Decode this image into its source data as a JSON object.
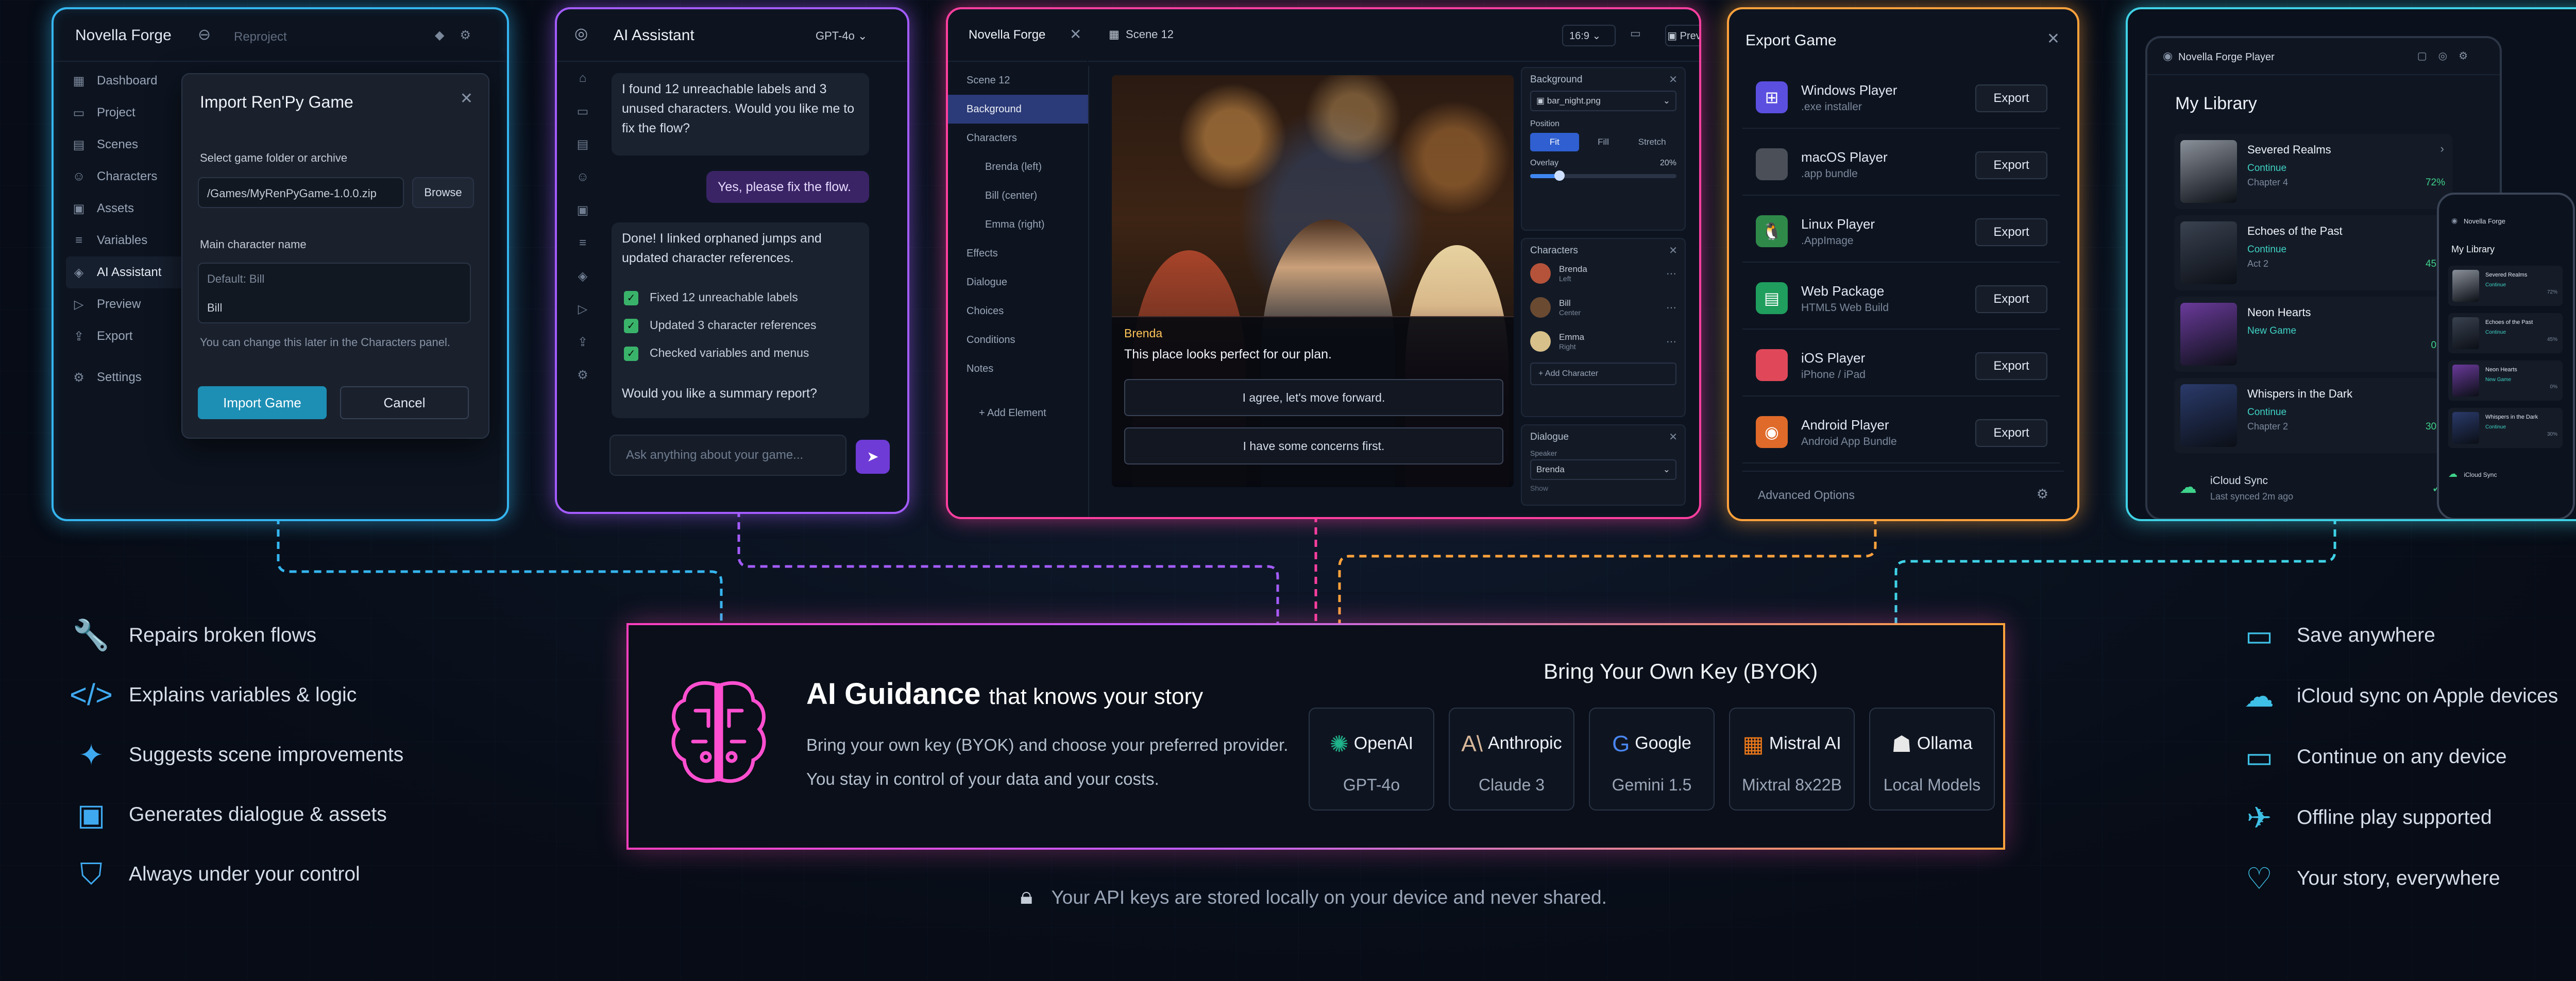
{
  "colors": {
    "blue": "#35b6f0",
    "purple": "#a45cff",
    "pink": "#ff3fa0",
    "orange": "#ffa23c",
    "cyan": "#3fd2e6"
  },
  "import_panel": {
    "brand": "Novella Forge",
    "crumb": "Reproject",
    "sidebar": [
      {
        "icon": "grid-icon",
        "label": "Dashboard"
      },
      {
        "icon": "folder-icon",
        "label": "Project"
      },
      {
        "icon": "scenes-icon",
        "label": "Scenes"
      },
      {
        "icon": "users-icon",
        "label": "Characters"
      },
      {
        "icon": "image-icon",
        "label": "Assets"
      },
      {
        "icon": "variable-icon",
        "label": "Variables"
      },
      {
        "icon": "ai-icon",
        "label": "AI Assistant"
      },
      {
        "icon": "play-icon",
        "label": "Preview"
      },
      {
        "icon": "export-icon",
        "label": "Export"
      },
      {
        "icon": "gear-icon",
        "label": "Settings"
      }
    ],
    "modal": {
      "title": "Import Ren'Py Game",
      "folder_label": "Select game folder or archive",
      "folder_value": "/Games/MyRenPyGame-1.0.0.zip",
      "browse": "Browse",
      "name_label": "Main character name",
      "name_placeholder": "Default: Bill",
      "name_value": "Bill",
      "hint": "You can change this later in the Characters panel.",
      "import_btn": "Import Game",
      "cancel_btn": "Cancel"
    }
  },
  "assistant_panel": {
    "title": "AI Assistant",
    "model": "GPT-4o",
    "msg1": "I found 12 unreachable labels and 3 unused characters. Would you like me to fix the flow?",
    "user_msg": "Yes, please fix the flow.",
    "msg2": "Done! I linked orphaned jumps and updated character references.",
    "checks": [
      "Fixed 12 unreachable labels",
      "Updated 3 character references",
      "Checked variables and menus"
    ],
    "followup": "Would you like a summary report?",
    "input_placeholder": "Ask anything about your game..."
  },
  "editor_panel": {
    "brand": "Novella Forge",
    "scene_tab": "Scene 12",
    "ratio": "16:9",
    "preview": "Preview",
    "tree": [
      "Scene 12",
      "Background",
      "Characters",
      "Brenda (left)",
      "Bill (center)",
      "Emma (right)",
      "Effects",
      "Dialogue",
      "Choices",
      "Conditions",
      "Notes"
    ],
    "add_element": "+ Add Element",
    "speaker": "Brenda",
    "line": "This place looks perfect for our plan.",
    "choices": [
      "I agree, let's move forward.",
      "I have some concerns first."
    ],
    "props": {
      "background_title": "Background",
      "background_file": "bar_night.png",
      "position_label": "Position",
      "position_options": [
        "Fit",
        "Fill",
        "Stretch"
      ],
      "overlay_label": "Overlay",
      "overlay_value": "20%",
      "overlay_fraction": 0.2,
      "characters_title": "Characters",
      "characters": [
        {
          "name": "Brenda",
          "pos": "Left",
          "color": "#b5533a"
        },
        {
          "name": "Bill",
          "pos": "Center",
          "color": "#6b4a32"
        },
        {
          "name": "Emma",
          "pos": "Right",
          "color": "#d8c08a"
        }
      ],
      "add_character": "+ Add Character",
      "dialogue_title": "Dialogue",
      "speaker_label": "Speaker",
      "speaker_value": "Brenda",
      "next_label": "Show"
    }
  },
  "export_panel": {
    "title": "Export Game",
    "targets": [
      {
        "name": "Windows Player",
        "sub": ".exe installer",
        "icon": "windows-icon",
        "glyph": "⊞",
        "color": "#5b4fe0"
      },
      {
        "name": "macOS Player",
        "sub": ".app bundle",
        "icon": "apple-icon",
        "glyph": "",
        "color": "#4a4f58"
      },
      {
        "name": "Linux Player",
        "sub": ".AppImage",
        "icon": "linux-icon",
        "glyph": "🐧",
        "color": "#2f8a4a"
      },
      {
        "name": "Web Package",
        "sub": "HTML5 Web Build",
        "icon": "web-icon",
        "glyph": "▤",
        "color": "#1f9e5e"
      },
      {
        "name": "iOS Player",
        "sub": "iPhone / iPad",
        "icon": "ios-icon",
        "glyph": "",
        "color": "#e0485a"
      },
      {
        "name": "Android Player",
        "sub": "Android App Bundle",
        "icon": "android-icon",
        "glyph": "◉",
        "color": "#e06a2a"
      }
    ],
    "export_label": "Export",
    "advanced": "Advanced Options"
  },
  "player_panel": {
    "app": "Novella Forge Player",
    "library": "My Library",
    "games": [
      {
        "title": "Severed Realms",
        "status": "Continue",
        "chapter": "Chapter 4",
        "progress": "72%",
        "cover": "#8a9099"
      },
      {
        "title": "Echoes of the Past",
        "status": "Continue",
        "chapter": "Act 2",
        "progress": "45%",
        "cover": "#3a4250"
      },
      {
        "title": "Neon Hearts",
        "status": "New Game",
        "chapter": "",
        "progress": "0%",
        "cover": "#6a3a9a"
      },
      {
        "title": "Whispers in the Dark",
        "status": "Continue",
        "chapter": "Chapter 2",
        "progress": "30%",
        "cover": "#2a3a6a"
      }
    ],
    "sync_title": "iCloud Sync",
    "sync_sub": "Last synced 2m ago",
    "phone_app": "Novella Forge",
    "phone_library": "My Library",
    "phone_games": [
      {
        "title": "Severed Realms",
        "status": "Continue",
        "progress": "72%"
      },
      {
        "title": "Echoes of the Past",
        "status": "Continue",
        "progress": "45%"
      },
      {
        "title": "Neon Hearts",
        "status": "New Game",
        "progress": "0%"
      },
      {
        "title": "Whispers in the Dark",
        "status": "Continue",
        "progress": "30%"
      }
    ],
    "phone_sync": "iCloud Sync"
  },
  "guidance": {
    "title": "AI Guidance",
    "title_suffix": "that knows your story",
    "desc1": "Bring your own key (BYOK) and choose your preferred provider.",
    "desc2": "You stay in control of your data and your costs.",
    "byok": "Bring Your Own Key (BYOK)",
    "providers": [
      {
        "name": "OpenAI",
        "model": "GPT-4o",
        "icon": "openai-icon",
        "glyph": "✺",
        "color": "#1fb38a"
      },
      {
        "name": "Anthropic",
        "model": "Claude 3",
        "icon": "anthropic-icon",
        "glyph": "A\\",
        "color": "#d9b89a"
      },
      {
        "name": "Google",
        "model": "Gemini 1.5",
        "icon": "google-icon",
        "glyph": "G",
        "color": "#4a86f0"
      },
      {
        "name": "Mistral AI",
        "model": "Mixtral 8x22B",
        "icon": "mistral-icon",
        "glyph": "▦",
        "color": "#f07a1a"
      },
      {
        "name": "Ollama",
        "model": "Local Models",
        "icon": "ollama-icon",
        "glyph": "☗",
        "color": "#e8e8e8"
      }
    ]
  },
  "left_features": [
    {
      "icon": "wrench-icon",
      "glyph": "🔧",
      "label": "Repairs broken flows"
    },
    {
      "icon": "code-icon",
      "glyph": "</>",
      "label": "Explains variables & logic"
    },
    {
      "icon": "sparkle-icon",
      "glyph": "✦",
      "label": "Suggests scene improvements"
    },
    {
      "icon": "chat-icon",
      "glyph": "▣",
      "label": "Generates dialogue & assets"
    },
    {
      "icon": "shield-check-icon",
      "glyph": "⛉",
      "label": "Always under your control"
    }
  ],
  "right_features": [
    {
      "icon": "save-icon",
      "glyph": "▭",
      "label": "Save anywhere"
    },
    {
      "icon": "cloud-icon",
      "glyph": "☁",
      "label": "iCloud sync on Apple devices"
    },
    {
      "icon": "monitor-icon",
      "glyph": "▭",
      "label": "Continue on any device"
    },
    {
      "icon": "plane-icon",
      "glyph": "✈",
      "label": "Offline play supported"
    },
    {
      "icon": "heart-icon",
      "glyph": "♡",
      "label": "Your story, everywhere"
    }
  ],
  "api_note": "Your API keys are stored locally on your device and never shared."
}
